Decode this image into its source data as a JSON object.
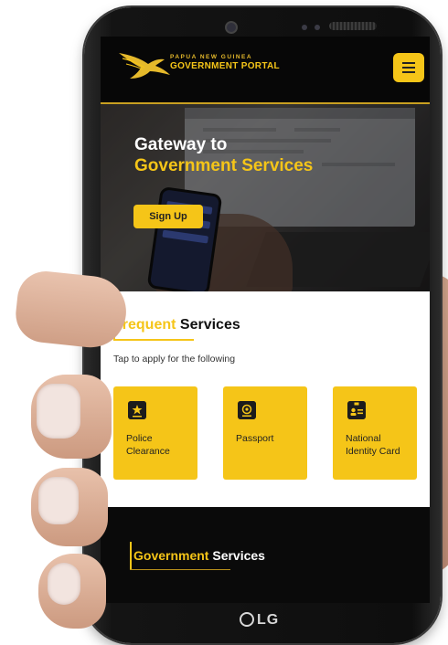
{
  "header": {
    "logo_small": "PAPUA NEW GUINEA",
    "logo_big": "GOVERNMENT PORTAL",
    "menu_icon": "hamburger-menu-icon"
  },
  "hero": {
    "line1": "Gateway to",
    "line2": "Government Services",
    "signup_label": "Sign Up"
  },
  "frequent": {
    "title_accent": "Frequent",
    "title_rest": "Services",
    "subtitle": "Tap to apply for the following",
    "cards": [
      {
        "label": "Police Clearance",
        "icon": "police-badge-icon"
      },
      {
        "label": "Passport",
        "icon": "passport-icon"
      },
      {
        "label": "National Identity Card",
        "icon": "id-card-icon"
      }
    ]
  },
  "government": {
    "title_accent": "Government",
    "title_rest": "Services"
  },
  "device": {
    "brand": "LG"
  },
  "colors": {
    "accent": "#f5c518",
    "dark": "#0a0a0a"
  }
}
